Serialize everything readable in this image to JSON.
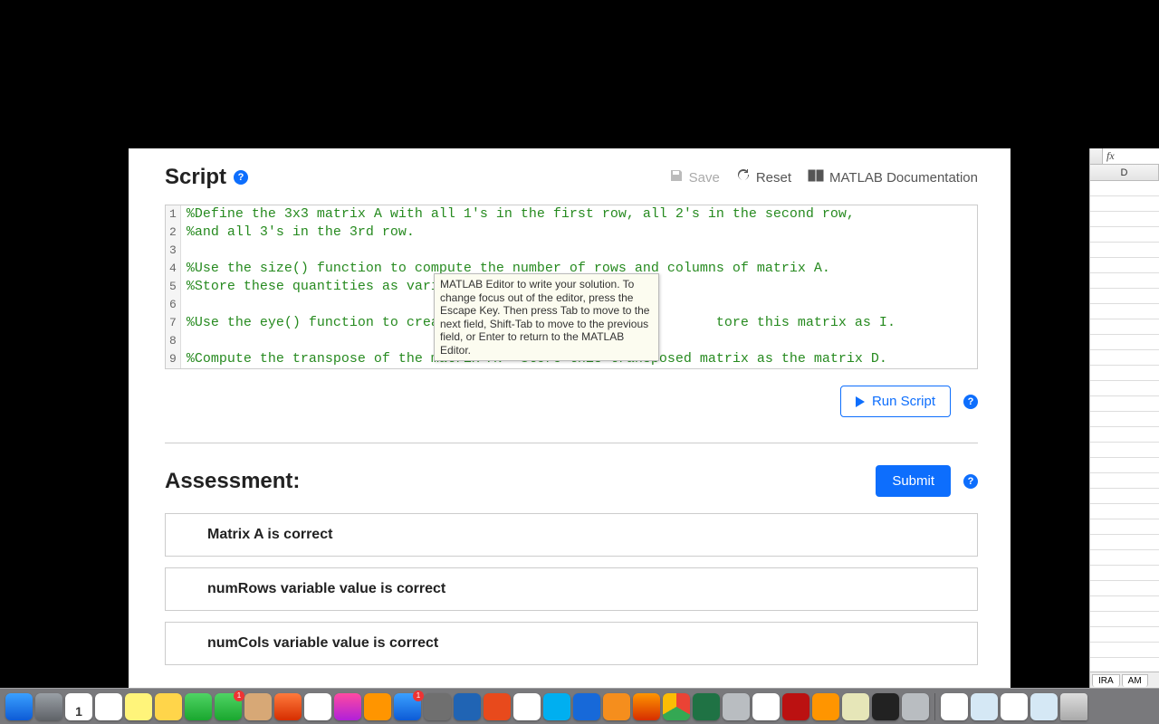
{
  "script": {
    "title": "Script",
    "save": "Save",
    "reset": "Reset",
    "docs": "MATLAB Documentation",
    "lines": [
      "%Define the 3x3 matrix A with all 1's in the first row, all 2's in the second row,",
      "%and all 3's in the 3rd row.",
      "",
      "%Use the size() function to compute the number of rows and columns of matrix A.",
      "%Store these quantities as varia",
      "",
      "%Use the eye() function to creat                                 tore this matrix as I.",
      "",
      "%Compute the transpose of the matrix A.  Store this transposed matrix as the matrix D."
    ],
    "line_numbers": [
      "1",
      "2",
      "3",
      "4",
      "5",
      "6",
      "7",
      "8",
      "9"
    ],
    "tooltip": "MATLAB Editor to write your solution. To change focus out of the editor, press the Escape Key. Then press Tab to move to the next field, Shift-Tab to move to the previous field, or Enter to return to the MATLAB Editor.",
    "run": "Run Script"
  },
  "assessment": {
    "title": "Assessment:",
    "submit": "Submit",
    "items": [
      "Matrix A is correct",
      "numRows variable value is correct",
      "numCols variable value is correct"
    ]
  },
  "sheet": {
    "fx": "fx",
    "col": "D",
    "tab1": "IRA",
    "tab2": "AM"
  },
  "dock": {
    "icons": [
      {
        "name": "finder",
        "bg": "linear-gradient(#3aa0ff,#0d5bd6)"
      },
      {
        "name": "launchpad",
        "bg": "linear-gradient(#9aa0a6,#5f6368)"
      },
      {
        "name": "calendar",
        "bg": "#fff",
        "text": "1"
      },
      {
        "name": "reminders",
        "bg": "#fff"
      },
      {
        "name": "notes",
        "bg": "#fff47a"
      },
      {
        "name": "stickies",
        "bg": "#ffd54a"
      },
      {
        "name": "messages",
        "bg": "linear-gradient(#4fd464,#1aa72f)"
      },
      {
        "name": "facetime",
        "bg": "linear-gradient(#4fd464,#1aa72f)",
        "badge": true
      },
      {
        "name": "contacts",
        "bg": "#d7a876"
      },
      {
        "name": "photobooth",
        "bg": "linear-gradient(#ff7a3c,#d62e00)"
      },
      {
        "name": "photos",
        "bg": "#fff"
      },
      {
        "name": "itunes",
        "bg": "linear-gradient(#ff4aa1,#b020d9)"
      },
      {
        "name": "ibooks",
        "bg": "#ff9500"
      },
      {
        "name": "appstore",
        "bg": "linear-gradient(#3aa0ff,#0d5bd6)",
        "badge": true
      },
      {
        "name": "sysprefs",
        "bg": "#6f6f6f"
      },
      {
        "name": "word",
        "bg": "#2064b4"
      },
      {
        "name": "powerpoint",
        "bg": "#e84a1c"
      },
      {
        "name": "onedrive",
        "bg": "#fff"
      },
      {
        "name": "skype",
        "bg": "#00aff0"
      },
      {
        "name": "teamviewer",
        "bg": "#1769d9"
      },
      {
        "name": "vlc",
        "bg": "#f58e1d"
      },
      {
        "name": "firefox",
        "bg": "linear-gradient(#ff9500,#d62e00)"
      },
      {
        "name": "chrome",
        "bg": "conic-gradient(#ea4335 0 120deg,#34a853 120deg 240deg,#fbbc05 240deg 360deg)"
      },
      {
        "name": "excel",
        "bg": "#1f7244"
      },
      {
        "name": "help",
        "bg": "#b9bdc1"
      },
      {
        "name": "mail",
        "bg": "#fff"
      },
      {
        "name": "adobe",
        "bg": "#b11"
      },
      {
        "name": "settings2",
        "bg": "#ff9500"
      },
      {
        "name": "docs2",
        "bg": "#e6e6b8"
      },
      {
        "name": "terminal",
        "bg": "#222"
      },
      {
        "name": "help2",
        "bg": "#b9bdc1"
      }
    ],
    "right_icons": [
      {
        "name": "doc1",
        "bg": "#fff"
      },
      {
        "name": "doc2",
        "bg": "#d5e8f5"
      },
      {
        "name": "doc3",
        "bg": "#fff"
      },
      {
        "name": "doc4",
        "bg": "#d5e8f5"
      }
    ]
  }
}
